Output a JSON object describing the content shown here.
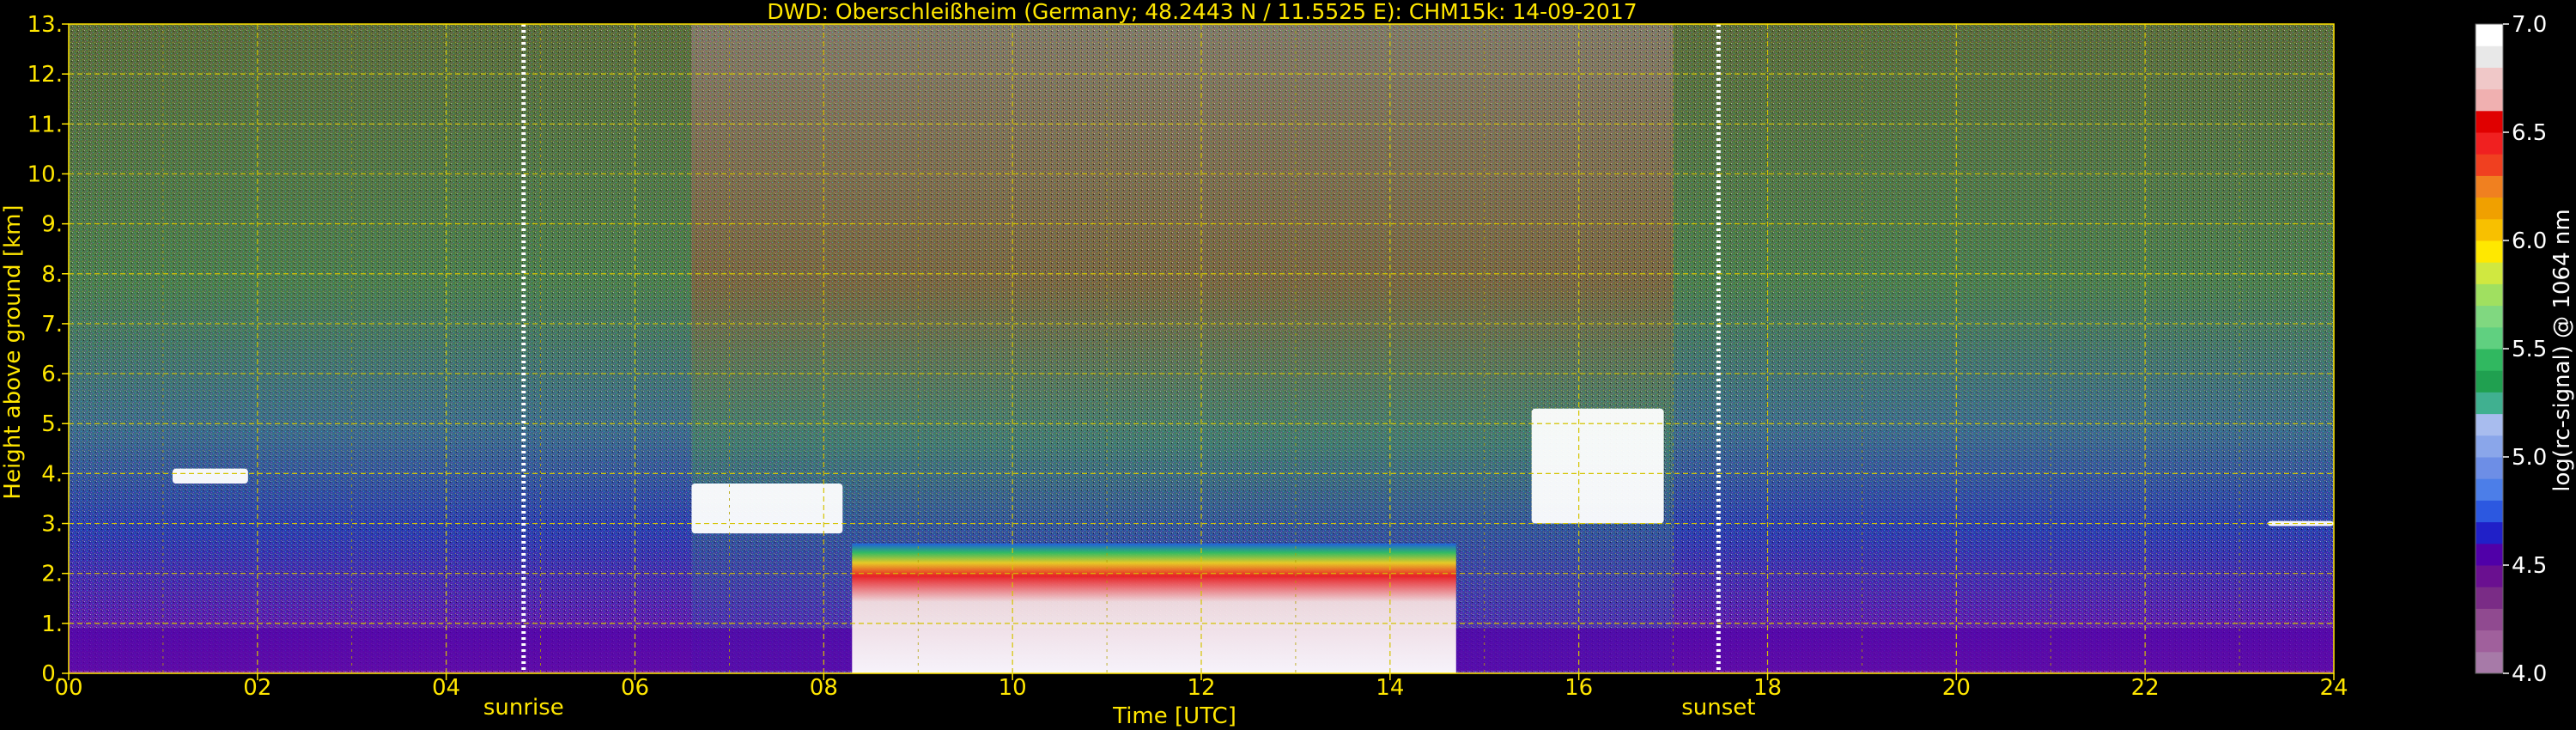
{
  "chart_data": {
    "type": "heatmap",
    "title": "DWD: Oberschleißheim (Germany; 48.2443 N / 11.5525 E):    CHM15k: 14-09-2017",
    "xlabel": "Time [UTC]",
    "ylabel": "Height above ground [km]",
    "xlim": [
      0,
      24
    ],
    "ylim": [
      0,
      13
    ],
    "x_ticks": [
      "00",
      "02",
      "04",
      "06",
      "08",
      "10",
      "12",
      "14",
      "16",
      "18",
      "20",
      "22",
      "24"
    ],
    "y_ticks": [
      "0.",
      "1.",
      "2.",
      "3.",
      "4.",
      "5.",
      "6.",
      "7.",
      "8.",
      "9.",
      "10.",
      "11.",
      "12.",
      "13."
    ],
    "grid": true,
    "markers": [
      {
        "label": "sunrise",
        "x": 4.82
      },
      {
        "label": "sunset",
        "x": 17.48
      }
    ],
    "colorbar": {
      "label": "log(rc-signal) @ 1064 nm",
      "range": [
        4.0,
        7.0
      ],
      "ticks": [
        "4.0",
        "4.5",
        "5.0",
        "5.5",
        "6.0",
        "6.5",
        "7.0"
      ],
      "colors": [
        "#a77aa8",
        "#a0609c",
        "#904a90",
        "#7a2c86",
        "#6a1090",
        "#5000a8",
        "#2020c8",
        "#2c58e0",
        "#4c7ee8",
        "#6d8ee6",
        "#8aa6ea",
        "#a8bcee",
        "#40b090",
        "#20a050",
        "#30b860",
        "#60d080",
        "#80d880",
        "#a0e060",
        "#d0e840",
        "#ffe800",
        "#f8c000",
        "#f0a000",
        "#f08020",
        "#f04020",
        "#f02020",
        "#e00000",
        "#f0b0b0",
        "#f0c8c8",
        "#e8e8e8",
        "#ffffff"
      ]
    },
    "features": [
      {
        "desc": "aerosol layer",
        "x_range": [
          0,
          24
        ],
        "height_km": [
          0.05,
          0.9
        ],
        "level": 4.5
      },
      {
        "desc": "boundary layer",
        "x_range": [
          8.3,
          14.7
        ],
        "height_km": [
          0.0,
          2.6
        ],
        "level": 6.5
      },
      {
        "desc": "cloud",
        "x_range": [
          1.1,
          1.9
        ],
        "height_km": [
          3.8,
          4.1
        ],
        "level": 7.0
      },
      {
        "desc": "cloud",
        "x_range": [
          6.6,
          8.2
        ],
        "height_km": [
          2.8,
          3.8
        ],
        "level": 7.0
      },
      {
        "desc": "cloud",
        "x_range": [
          15.5,
          16.9
        ],
        "height_km": [
          3.0,
          5.3
        ],
        "level": 7.0
      },
      {
        "desc": "cloud",
        "x_range": [
          23.3,
          24.0
        ],
        "height_km": [
          2.95,
          3.05
        ],
        "level": 7.0
      }
    ]
  }
}
